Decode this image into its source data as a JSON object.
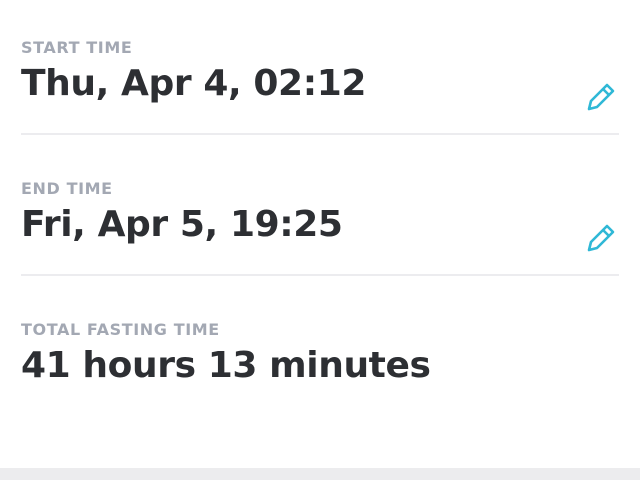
{
  "start": {
    "label": "START TIME",
    "value": "Thu, Apr 4, 02:12",
    "edit_icon": "pencil-icon"
  },
  "end": {
    "label": "END TIME",
    "value": "Fri, Apr 5, 19:25",
    "edit_icon": "pencil-icon"
  },
  "total": {
    "label": "TOTAL FASTING TIME",
    "value": "41 hours 13 minutes"
  },
  "colors": {
    "label": "#a3a8b3",
    "value": "#2d2f33",
    "accent": "#2fb8d6",
    "divider": "#ececef"
  }
}
